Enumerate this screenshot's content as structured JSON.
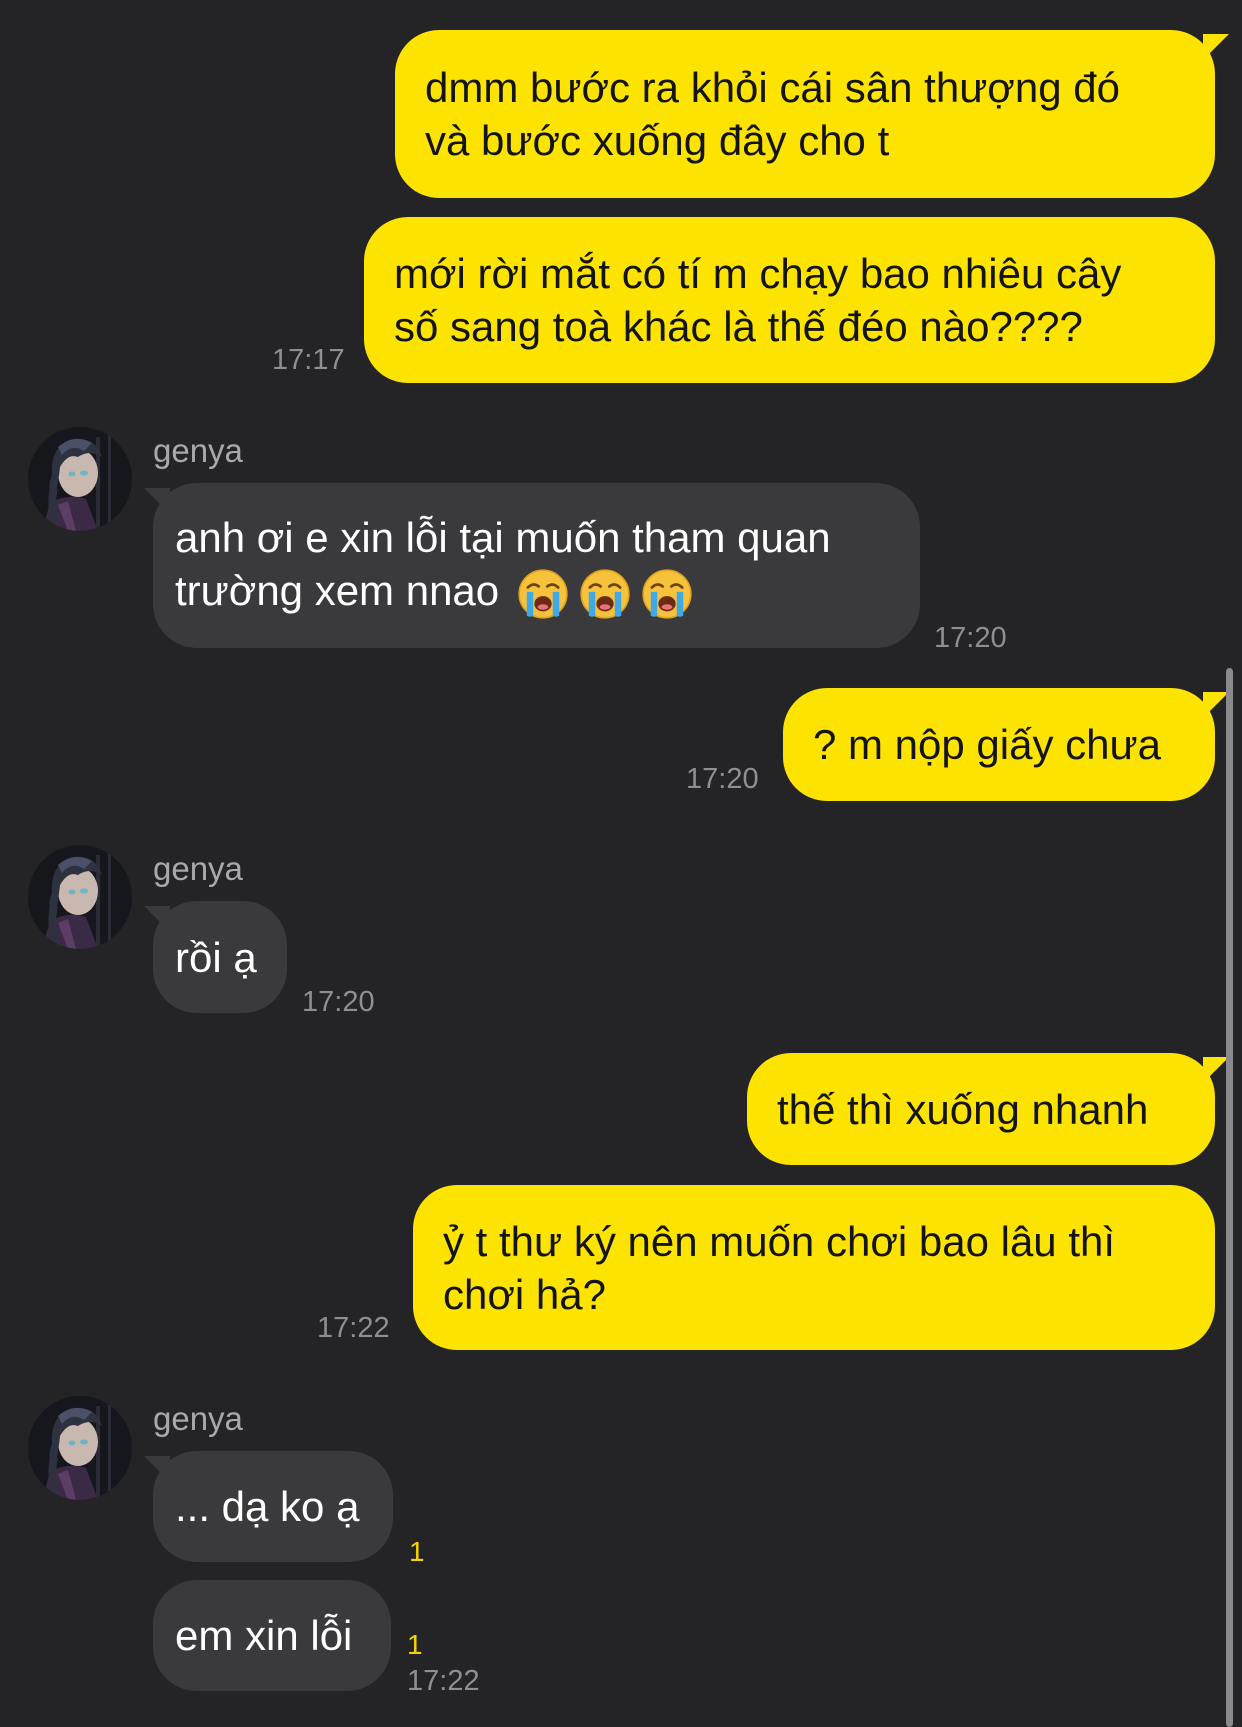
{
  "conversation": {
    "contact_name": "genya",
    "messages": [
      {
        "from": "me",
        "lines": [
          "dmm bước ra khỏi cái sân thượng đó",
          "và bước xuống đây cho t"
        ]
      },
      {
        "from": "me",
        "lines": [
          "mới rời mắt có tí m chạy bao nhiêu cây",
          "số sang toà khác là thế đéo nào????"
        ],
        "time": "17:17"
      },
      {
        "from": "genya",
        "sender": "genya",
        "lines": [
          "anh ơi e xin lỗi tại muốn tham quan",
          "trường xem nnao"
        ],
        "emoji": [
          "loudly-crying-face",
          "loudly-crying-face",
          "loudly-crying-face"
        ],
        "time": "17:20"
      },
      {
        "from": "me",
        "lines": [
          "? m nộp giấy chưa"
        ],
        "time": "17:20"
      },
      {
        "from": "genya",
        "sender": "genya",
        "lines": [
          "rồi ạ"
        ],
        "time": "17:20"
      },
      {
        "from": "me",
        "lines": [
          "thế thì xuống nhanh"
        ]
      },
      {
        "from": "me",
        "lines": [
          "ỷ t thư ký nên muốn chơi bao lâu thì",
          "chơi hả?"
        ],
        "time": "17:22"
      },
      {
        "from": "genya",
        "sender": "genya",
        "lines": [
          "... dạ ko ạ"
        ],
        "unread": "1"
      },
      {
        "from": "genya",
        "lines": [
          "em xin lỗi"
        ],
        "unread": "1",
        "time": "17:22"
      }
    ]
  },
  "colors": {
    "background": "#242426",
    "my_bubble": "#fde400",
    "their_bubble": "#3a3a3c",
    "timestamp": "#8e8e93",
    "unread_count": "#f5d300"
  },
  "icons": {
    "avatar": "anime-character-avatar",
    "emoji": "loudly-crying-face"
  }
}
